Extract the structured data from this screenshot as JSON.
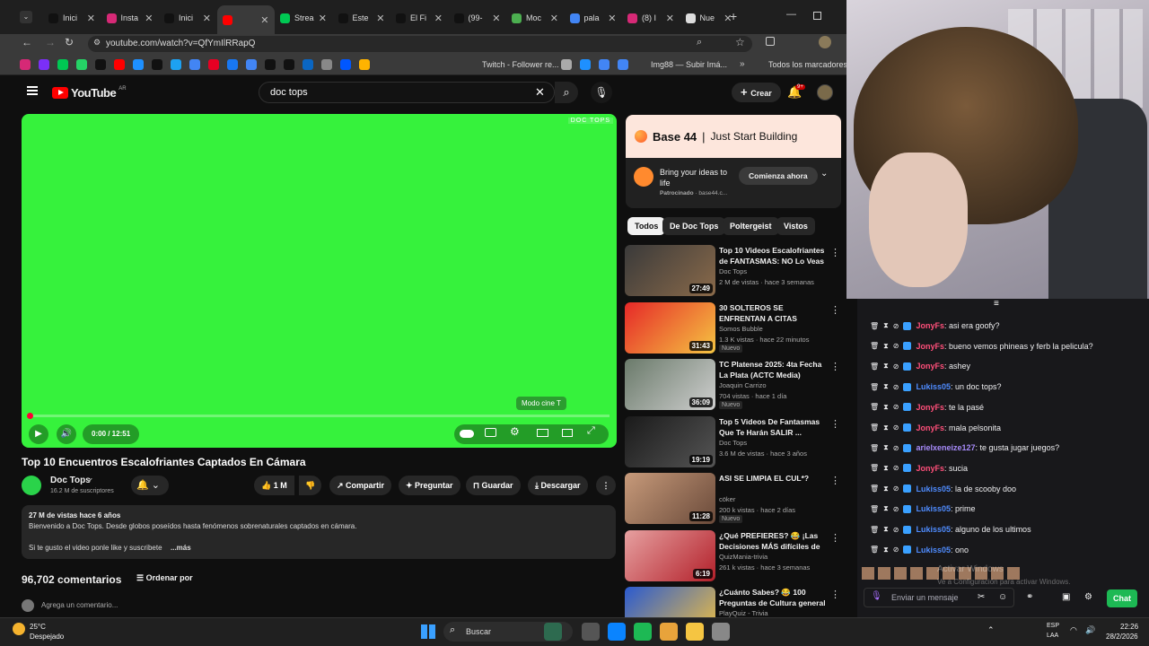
{
  "browser": {
    "tabs": [
      {
        "label": "Inici",
        "color": "#111"
      },
      {
        "label": "Insta",
        "color": "#d62976"
      },
      {
        "label": "Inici",
        "color": "#111"
      },
      {
        "label": "",
        "color": "#ff0000"
      },
      {
        "label": "Strea",
        "color": "#00c853"
      },
      {
        "label": "Este",
        "color": "#111"
      },
      {
        "label": "El Fi",
        "color": "#111"
      },
      {
        "label": "(99-",
        "color": "#111"
      },
      {
        "label": "Moc",
        "color": "#4caf50"
      },
      {
        "label": "pala",
        "color": "#4285f4"
      },
      {
        "label": "(8) I",
        "color": "#d62976"
      },
      {
        "label": "Nue",
        "color": "#ddd"
      }
    ],
    "url": "youtube.com/watch?v=QfYmIlRRapQ",
    "bookmarks": {
      "twitch": "Twitch - Follower re...",
      "img": "Img88 — Subir Imá...",
      "all": "Todos los marcadores"
    }
  },
  "youtube": {
    "logo": "YouTube",
    "region": "AR",
    "search_value": "doc tops",
    "create": "Crear",
    "notif_count": "9+",
    "player": {
      "watermark": "DOC TOPS",
      "tooltip": "Modo cine",
      "tooltip_key": "T",
      "time": "0:00 / 12:51",
      "progress": 0.0
    },
    "video_title": "Top 10 Encuentros Escalofriantes Captados En Cámara",
    "channel": {
      "name": "Doc Tops",
      "subs": "16.2 M de suscriptores"
    },
    "actions": {
      "likes": "1 M",
      "share": "Compartir",
      "ask": "Preguntar",
      "save": "Guardar",
      "download": "Descargar"
    },
    "description": {
      "meta": "27 M de vistas  hace 6 años",
      "text": "Bienvenido a Doc Tops. Desde globos poseídos hasta fenómenos sobrenaturales captados en cámara.",
      "line2": "Si te gusto el video ponle like y suscribete",
      "more": "...más"
    },
    "comments": {
      "count": "96,702 comentarios",
      "sort": "Ordenar por",
      "placeholder": "Agrega un comentario..."
    },
    "ad": {
      "brand": "Base 44",
      "slogan": "Just Start Building",
      "title": "Bring your ideas to life",
      "sponsored": "Patrocinado",
      "domain": "base44.c...",
      "cta": "Comienza ahora"
    },
    "chips": [
      "Todos",
      "De Doc Tops",
      "Poltergeist",
      "Vistos"
    ],
    "recs": [
      {
        "title": "Top 10 Videos Escalofriantes de FANTASMAS: NO Lo Veas ...",
        "channel": "Doc Tops",
        "meta": "2 M de vistas · hace 3 semanas",
        "duration": "27:49",
        "badge": ""
      },
      {
        "title": "30 SOLTEROS SE ENFRENTAN A CITAS RAPIDAS",
        "channel": "Somos Bubble",
        "meta": "1.3 K vistas · hace 22 minutos",
        "duration": "31:43",
        "badge": "Nuevo"
      },
      {
        "title": "TC Platense 2025: 4ta Fecha La Plata (ACTC Media)",
        "channel": "Joaquin Carrizo",
        "meta": "704 vistas · hace 1 día",
        "duration": "36:09",
        "badge": "Nuevo"
      },
      {
        "title": "Top 5 Videos De Fantasmas Que Te Harán SALIR ...",
        "channel": "Doc Tops",
        "meta": "3.6 M de vistas · hace 3 años",
        "duration": "19:19",
        "badge": ""
      },
      {
        "title": "ASI SE LIMPIA EL CUL*?",
        "channel": "cöker",
        "meta": "200 k vistas · hace 2 días",
        "duration": "11:28",
        "badge": "Nuevo"
      },
      {
        "title": "¿Qué PREFIERES? 😂 ¡Las Decisiones MÁS difíciles de T...",
        "channel": "QuizMania-trivia",
        "meta": "261 k vistas · hace 3 semanas",
        "duration": "6:19",
        "badge": ""
      },
      {
        "title": "¿Cuánto Sabes? 😂 100 Preguntas de Cultura general ...",
        "channel": "PlayQuiz - Trivia",
        "meta": "",
        "duration": "",
        "badge": ""
      }
    ]
  },
  "chat": {
    "messages": [
      {
        "user": "JonyFs",
        "text": ": asi era goofy?",
        "color": "#ff4f7a"
      },
      {
        "user": "JonyFs",
        "text": ": bueno vemos phineas y ferb la pelicula?",
        "color": "#ff4f7a"
      },
      {
        "user": "JonyFs",
        "text": ": ashey",
        "color": "#ff4f7a"
      },
      {
        "user": "Lukiss05",
        "text": ": un doc tops?",
        "color": "#4f8cff"
      },
      {
        "user": "JonyFs",
        "text": ": te la pasé",
        "color": "#ff4f7a"
      },
      {
        "user": "JonyFs",
        "text": ": mala pelsonita",
        "color": "#ff4f7a"
      },
      {
        "user": "arielxeneize127",
        "text": ": te gusta jugar juegos?",
        "color": "#a78bfa"
      },
      {
        "user": "JonyFs",
        "text": ": sucia",
        "color": "#ff4f7a"
      },
      {
        "user": "Lukiss05",
        "text": ": la de scooby doo",
        "color": "#4f8cff"
      },
      {
        "user": "Lukiss05",
        "text": ": prime",
        "color": "#4f8cff"
      },
      {
        "user": "Lukiss05",
        "text": ": alguno de los ultimos",
        "color": "#4f8cff"
      },
      {
        "user": "Lukiss05",
        "text": ": ono",
        "color": "#4f8cff"
      }
    ],
    "input_placeholder": "Enviar un mensaje",
    "send": "Chat",
    "activate": "Activar Windows",
    "activate_sub": "Ve a Configuración para activar Windows."
  },
  "taskbar": {
    "temp": "25°C",
    "weather": "Despejado",
    "search": "Buscar",
    "lang1": "ESP",
    "lang2": "LAA",
    "time": "22:26",
    "date": "28/2/2026"
  }
}
